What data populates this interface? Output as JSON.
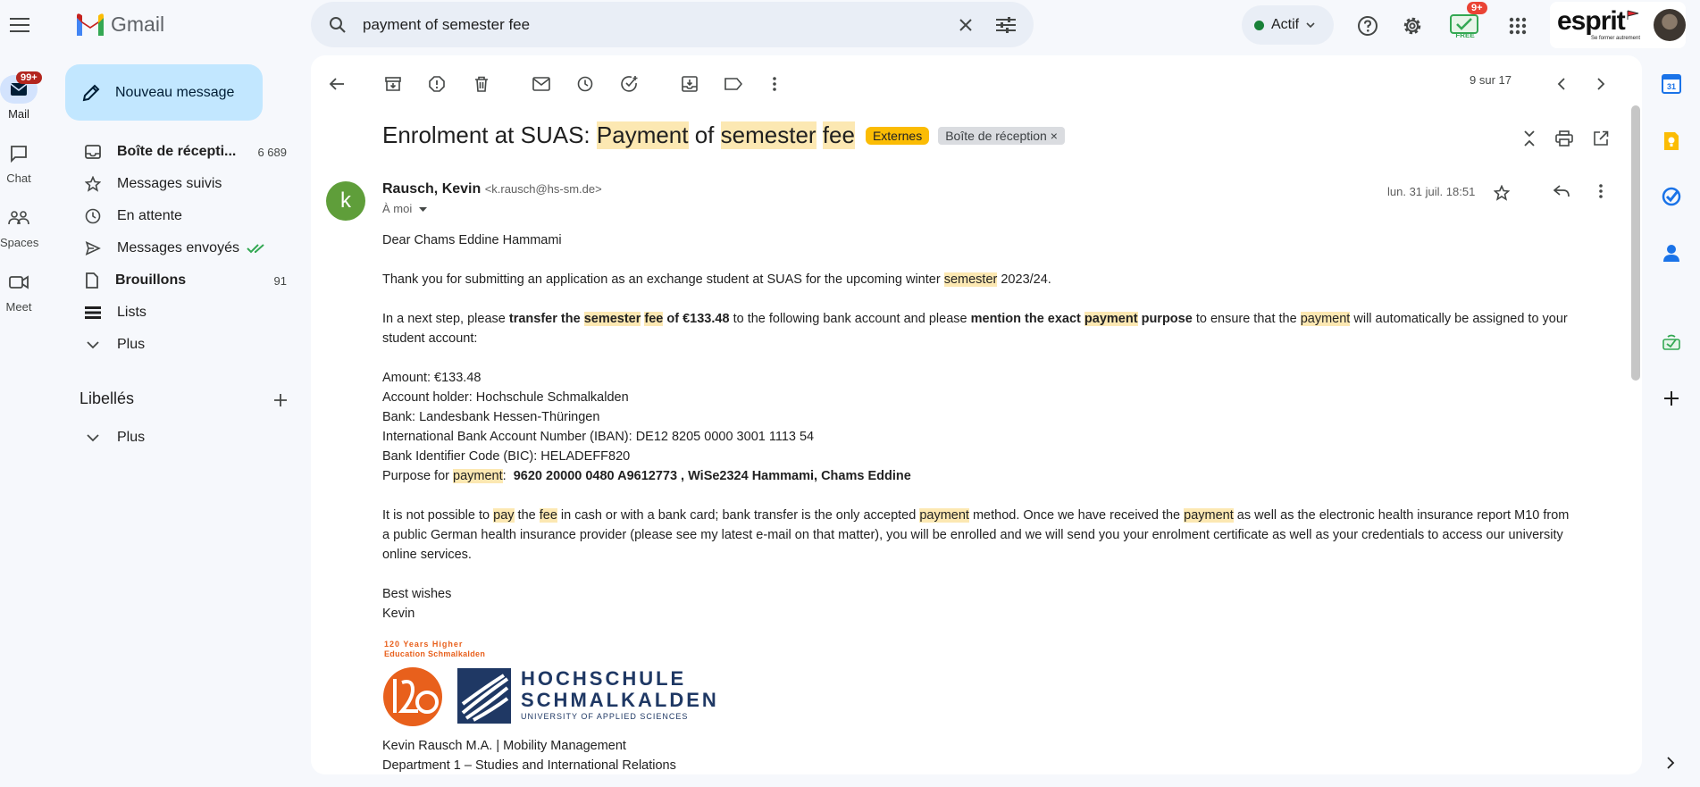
{
  "header": {
    "app_name": "Gmail",
    "search_value": "payment of semester fee",
    "status_label": "Actif",
    "meet_badge": "9+",
    "meet_free_label": "FREE",
    "account_brand": "esprit",
    "account_tagline": "Se former autrement"
  },
  "rail": {
    "mail_label": "Mail",
    "mail_badge": "99+",
    "chat_label": "Chat",
    "spaces_label": "Spaces",
    "meet_label": "Meet"
  },
  "compose_label": "Nouveau message",
  "nav": [
    {
      "label": "Boîte de récepti...",
      "count": "6 689"
    },
    {
      "label": "Messages suivis",
      "count": ""
    },
    {
      "label": "En attente",
      "count": ""
    },
    {
      "label": "Messages envoyés",
      "count": ""
    },
    {
      "label": "Brouillons",
      "count": "91"
    },
    {
      "label": "Lists",
      "count": ""
    },
    {
      "label": "Plus",
      "count": ""
    }
  ],
  "labels_heading": "Libellés",
  "labels_more": "Plus",
  "pagination": "9 sur 17",
  "email": {
    "subject_prefix": "Enrolment at SUAS: ",
    "subject_w1": "Payment",
    "subject_of": " of ",
    "subject_w2": "semester",
    "subject_w3": "fee",
    "tag_external": "Externes",
    "tag_inbox": "Boîte de réception",
    "sender_initial": "k",
    "sender_name": "Rausch, Kevin",
    "sender_email": "<k.rausch@hs-sm.de>",
    "to": "À moi",
    "date": "lun. 31 juil. 18:51",
    "greeting": "Dear Chams Eddine Hammami",
    "p1_a": "Thank you for submitting an application as an exchange student at SUAS for the upcoming winter ",
    "p1_hl": "semester",
    "p1_b": " 2023/24.",
    "p2_a": "In a next step, please ",
    "p2_b1": "transfer the ",
    "p2_hl1": "semester",
    "p2_hl2": "fee",
    "p2_b2": " of €133.48",
    "p2_c": " to the following bank account and please ",
    "p2_b3": "mention the exact ",
    "p2_hl3": "payment",
    "p2_b4": " purpose",
    "p2_d": " to ensure that the ",
    "p2_hl4": "payment",
    "p2_e": " will automatically be assigned to your student account:",
    "amount": "Amount: €133.48",
    "holder": "Account holder: Hochschule Schmalkalden",
    "bank": "Bank: Landesbank Hessen-Thüringen",
    "iban": "International Bank Account Number (IBAN): DE12 8205 0000 3001 1113 54",
    "bic": "Bank Identifier Code (BIC): HELADEFF820",
    "purpose_a": "Purpose for ",
    "purpose_hl": "payment",
    "purpose_b": ":  ",
    "purpose_value": "9620 20000 0480 A9612773 , WiSe2324 Hammami, Chams Eddine",
    "p3_a": "It is not possible to ",
    "p3_hl1": "pay",
    "p3_b": " the ",
    "p3_hl2": "fee",
    "p3_c": " in cash or with a bank card; bank transfer is the only accepted ",
    "p3_hl3": "payment",
    "p3_d": " method. Once we have received the ",
    "p3_hl4": "payment",
    "p3_e": " as well as the electronic health insurance report M10 from a public German health insurance provider (please see my latest e-mail on that matter), you will be enrolled and we will send you your enrolment certificate as well as your credentials to access our university online services.",
    "closing": "Best wishes",
    "closing_name": "Kevin",
    "logo_caption_1": "120 Years Higher",
    "logo_caption_2": "Education Schmalkalden",
    "logo_name_1": "HOCHSCHULE",
    "logo_name_2": "SCHMALKALDEN",
    "logo_name_3": "UNIVERSITY OF APPLIED SCIENCES",
    "sig_1": "Kevin Rausch M.A. | Mobility Management",
    "sig_2": "Department 1 – Studies and International Relations"
  },
  "colors": {
    "highlight": "#fce8b2",
    "compose_bg": "#c2e7ff",
    "tag_external": "#fbbc04",
    "avatar": "#5f9e3a",
    "hs_orange": "#e8601c",
    "hs_navy": "#1f3864"
  }
}
